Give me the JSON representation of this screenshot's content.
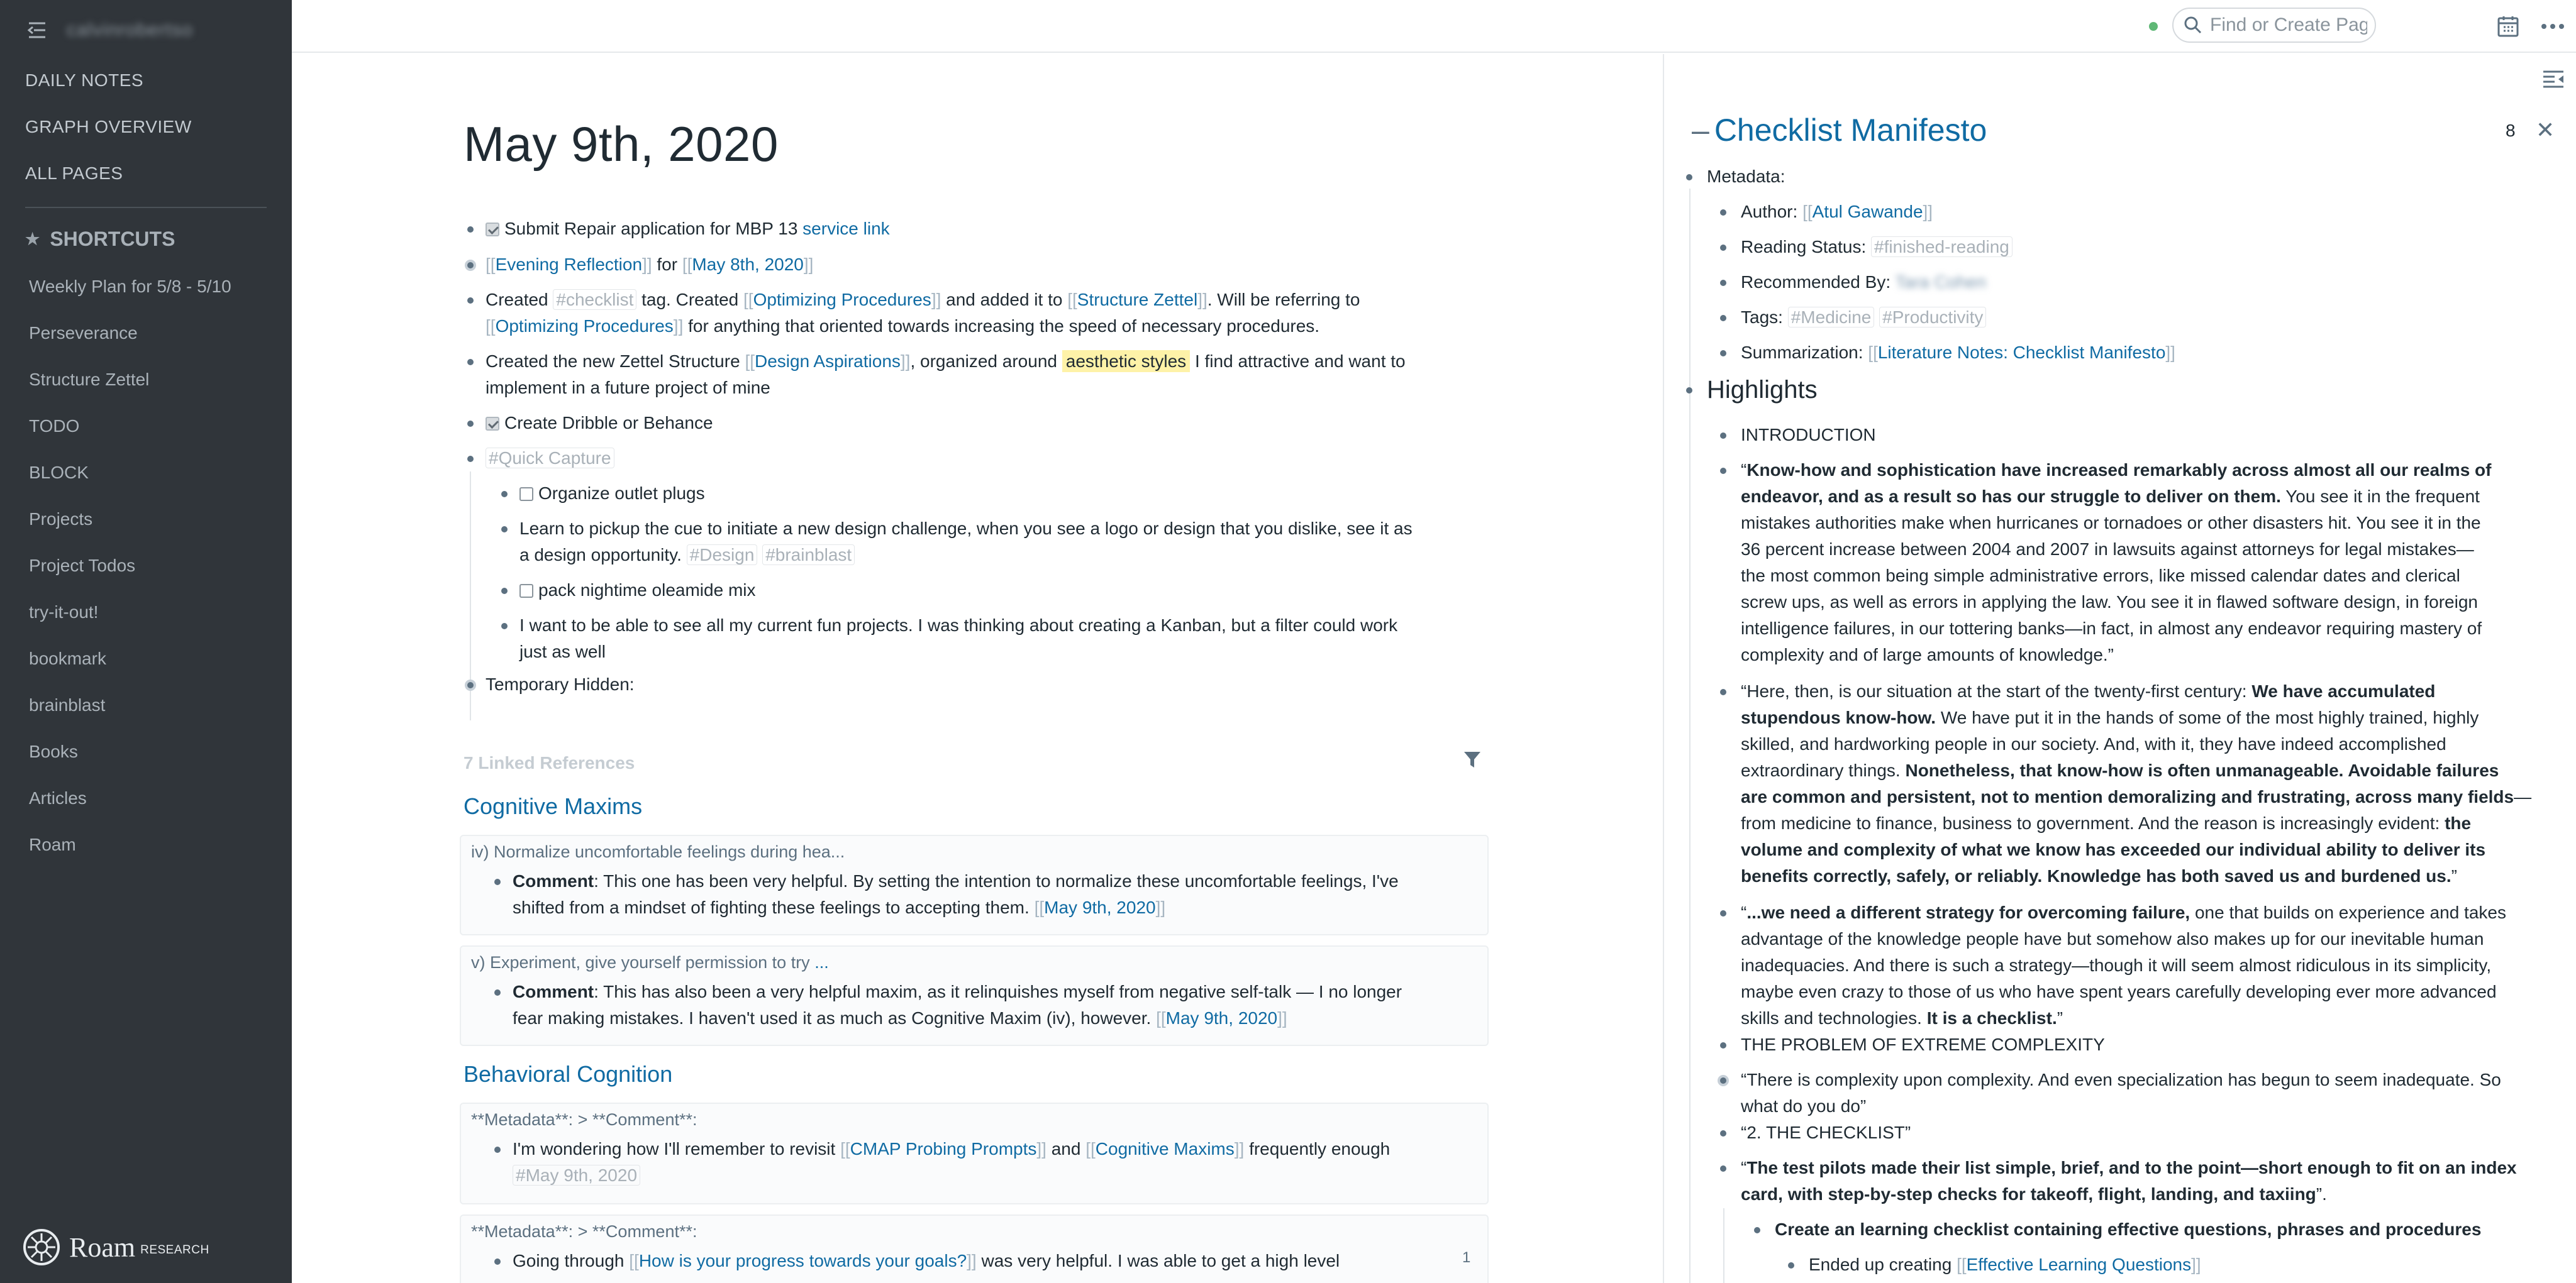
{
  "sidebar": {
    "graph_name": "calvinrobertso",
    "nav": [
      "DAILY NOTES",
      "GRAPH OVERVIEW",
      "ALL PAGES"
    ],
    "shortcuts_label": "SHORTCUTS",
    "shortcuts": [
      "Weekly Plan for 5/8 - 5/10",
      "Perseverance",
      "Structure Zettel",
      "TODO",
      "BLOCK",
      "Projects",
      "Project Todos",
      "try-it-out!",
      "bookmark",
      "brainblast",
      "Books",
      "Articles",
      "Roam"
    ],
    "logo_word": "Roam",
    "logo_sub": "RESEARCH"
  },
  "topbar": {
    "search_placeholder": "Find or Create Page"
  },
  "main": {
    "title": "May 9th, 2020",
    "blocks": {
      "b1_text": "Submit Repair application for MBP 13",
      "b1_link": "service link",
      "b2_ref1": "Evening Reflection",
      "b2_for": "for",
      "b2_ref2": "May 8th, 2020",
      "b3_a": "Created",
      "b3_tag": "#checklist",
      "b3_b": "tag.  Created",
      "b3_ref1": "Optimizing Procedures",
      "b3_c": "and added it to",
      "b3_ref2": "Structure Zettel",
      "b3_d": ".  Will be referring to",
      "b3_ref3": "Optimizing Procedures",
      "b3_e": "for anything that oriented towards increasing the speed of necessary procedures.",
      "b4_a": "Created the new Zettel Structure",
      "b4_ref": "Design Aspirations",
      "b4_b": ", organized around",
      "b4_hl": "aesthetic styles",
      "b4_c": "I find attractive and want to",
      "b4_d": "implement in a future project of mine",
      "b5_text": "Create Dribble or Behance",
      "b6_tag": "#Quick Capture",
      "c1_text": "Organize outlet plugs",
      "c2_a": "Learn to pickup the cue to initiate a new design challenge, when you see a logo or design that you dislike, see it as",
      "c2_b": "a design opportunity.",
      "c2_tag1": "#Design",
      "c2_tag2": "#brainblast",
      "c3_text": "pack nightime oleamide mix",
      "c4_a": "I want to be able to see all my current fun projects.  I was thinking about creating a Kanban, but a filter could work",
      "c4_b": "just as well",
      "b7_text": "Temporary Hidden:"
    },
    "linked_refs": {
      "header": "7 Linked References",
      "cm_title": "Cognitive Maxims",
      "cm1_crumb": "iv) Normalize uncomfortable feelings during hea...",
      "cm1_bold": "Comment",
      "cm1_a": ": This one has been very helpful.  By setting the intention to normalize these uncomfortable feelings, I've",
      "cm1_b": "shifted from a mindset of fighting these feelings to accepting them.",
      "cm1_ref": "May 9th, 2020",
      "cm2_crumb": "v) Experiment, give yourself permission to try",
      "cm2_ell": "...",
      "cm2_bold": "Comment",
      "cm2_a": ": This has also been a very helpful maxim, as it relinquishes myself from negative self-talk — I no longer",
      "cm2_b": "fear making mistakes.  I haven't used it as much as Cognitive Maxim (iv), however.",
      "cm2_ref": "May 9th, 2020",
      "bc_title": "Behavioral Cognition",
      "bc1_crumb_a": "**Metadata**:",
      "bc1_crumb_b": "**Comment**:",
      "bc1_a": "I'm wondering how I'll remember to revisit",
      "bc1_ref1": "CMAP Probing Prompts",
      "bc1_and": "and",
      "bc1_ref2": "Cognitive Maxims",
      "bc1_b": "frequently enough",
      "bc1_tag": "#May 9th, 2020",
      "bc2_crumb_a": "**Metadata**:",
      "bc2_crumb_b": "**Comment**:",
      "bc2_a": "Going through",
      "bc2_ref": "How is your progress towards your goals?",
      "bc2_b": "was very helpful.  I was able to get a high level",
      "bc2_count": "1"
    }
  },
  "right_panel": {
    "title": "Checklist Manifesto",
    "count": "8",
    "metadata_label": "Metadata:",
    "author_label": "Author:",
    "author": "Atul Gawande",
    "status_label": "Reading Status:",
    "status_tag": "#finished-reading",
    "rec_label": "Recommended By:",
    "rec_value": "Tara Cohen",
    "tags_label": "Tags:",
    "tag1": "#Medicine",
    "tag2": "#Productivity",
    "summ_label": "Summarization:",
    "summ_ref": "Literature Notes: Checklist Manifesto",
    "highlights": "Highlights",
    "intro": "INTRODUCTION",
    "q1_bold_a": "Know-how and sophistication have increased remarkably across almost all our realms of",
    "q1_bold_b": "endeavor, and as a result so has our struggle to deliver on them.",
    "q1_c": "You see it in the frequent",
    "q1_d": "mistakes authorities make when hurricanes or tornadoes or other disasters hit. You see it in the",
    "q1_e": "36 percent increase between 2004 and 2007 in lawsuits against attorneys for legal mistakes—",
    "q1_f": "the most common being simple administrative errors, like missed calendar dates and clerical",
    "q1_g": "screw ups, as well as errors in applying the law. You see it in flawed software design, in foreign",
    "q1_h": "intelligence failures, in our tottering banks—in fact, in almost any endeavor requiring mastery of",
    "q1_i": "complexity and of large amounts of knowledge.”",
    "q2_a": "“Here, then, is our situation at the start of the twenty-first century:",
    "q2_b": "We have accumulated",
    "q2_c": "stupendous know-how.",
    "q2_d": "We have put it in the hands of some of the most highly trained, highly",
    "q2_e": "skilled, and hardworking people in our society. And, with it, they have indeed accomplished",
    "q2_f": "extraordinary things.",
    "q2_g": "Nonetheless, that know-how is often unmanageable. Avoidable failures",
    "q2_h": "are common and persistent, not to mention demoralizing and frustrating, across many fields",
    "q2_i": "—",
    "q2_j": "from medicine to finance, business to government. And the reason is increasingly evident:",
    "q2_k": "the",
    "q2_l": "volume and complexity of what we know has exceeded our individual ability to deliver its",
    "q2_m": "benefits correctly, safely, or reliably. Knowledge has both saved us and burdened us.",
    "q2_n": "”",
    "q3_a": "“",
    "q3_b": "...we need a different strategy for overcoming failure,",
    "q3_c": "one that builds on experience and takes",
    "q3_d": "advantage of the knowledge people have but somehow also makes up for our inevitable human",
    "q3_e": "inadequacies. And there is such a strategy—though it will seem almost ridiculous in its simplicity,",
    "q3_f": "maybe even crazy to those of us who have spent years carefully developing ever more advanced",
    "q3_g": "skills and technologies.",
    "q3_h": "It is a checklist.",
    "q3_i": "”",
    "problem": "THE PROBLEM OF EXTREME COMPLEXITY",
    "q4_a": "“There is complexity upon complexity. And even specialization has begun to seem inadequate. So",
    "q4_b": "what do you do”",
    "q5": "“2. THE CHECKLIST”",
    "q6_a": "“",
    "q6_b": "The test pilots made their list simple, brief, and to the point—short enough to fit on an index",
    "q6_c": "card, with step-by-step checks for takeoff, flight, landing, and taxiing",
    "q6_d": "”.",
    "q7": "Create an learning checklist containing effective questions, phrases and procedures",
    "q8_a": "Ended up creating",
    "q8_ref": "Effective Learning Questions"
  }
}
